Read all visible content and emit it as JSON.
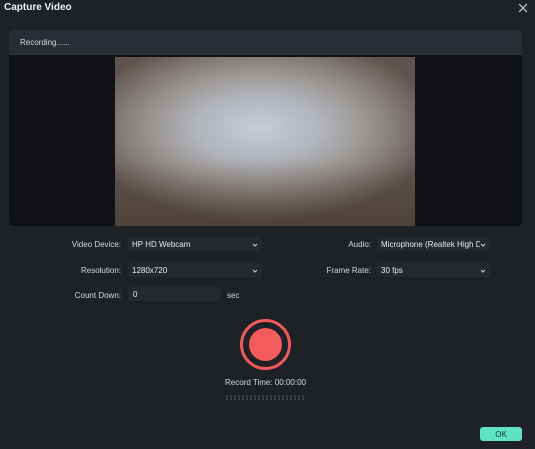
{
  "window": {
    "title": "Capture Video",
    "close_icon": "close-icon"
  },
  "preview": {
    "status": "Recording......"
  },
  "form": {
    "video_device": {
      "label": "Video Device:",
      "value": "HP HD Webcam"
    },
    "resolution": {
      "label": "Resolution:",
      "value": "1280x720"
    },
    "count_down": {
      "label": "Count Down:",
      "value": "0",
      "unit": "sec"
    },
    "audio": {
      "label": "Audio:",
      "value": "Microphone (Realtek High De"
    },
    "frame_rate": {
      "label": "Frame Rate:",
      "value": "30 fps"
    }
  },
  "record": {
    "time_label": "Record Time: 00:00:00",
    "button_color": "#f25c5c"
  },
  "footer": {
    "ok_label": "OK",
    "accent": "#5fe3c3"
  }
}
